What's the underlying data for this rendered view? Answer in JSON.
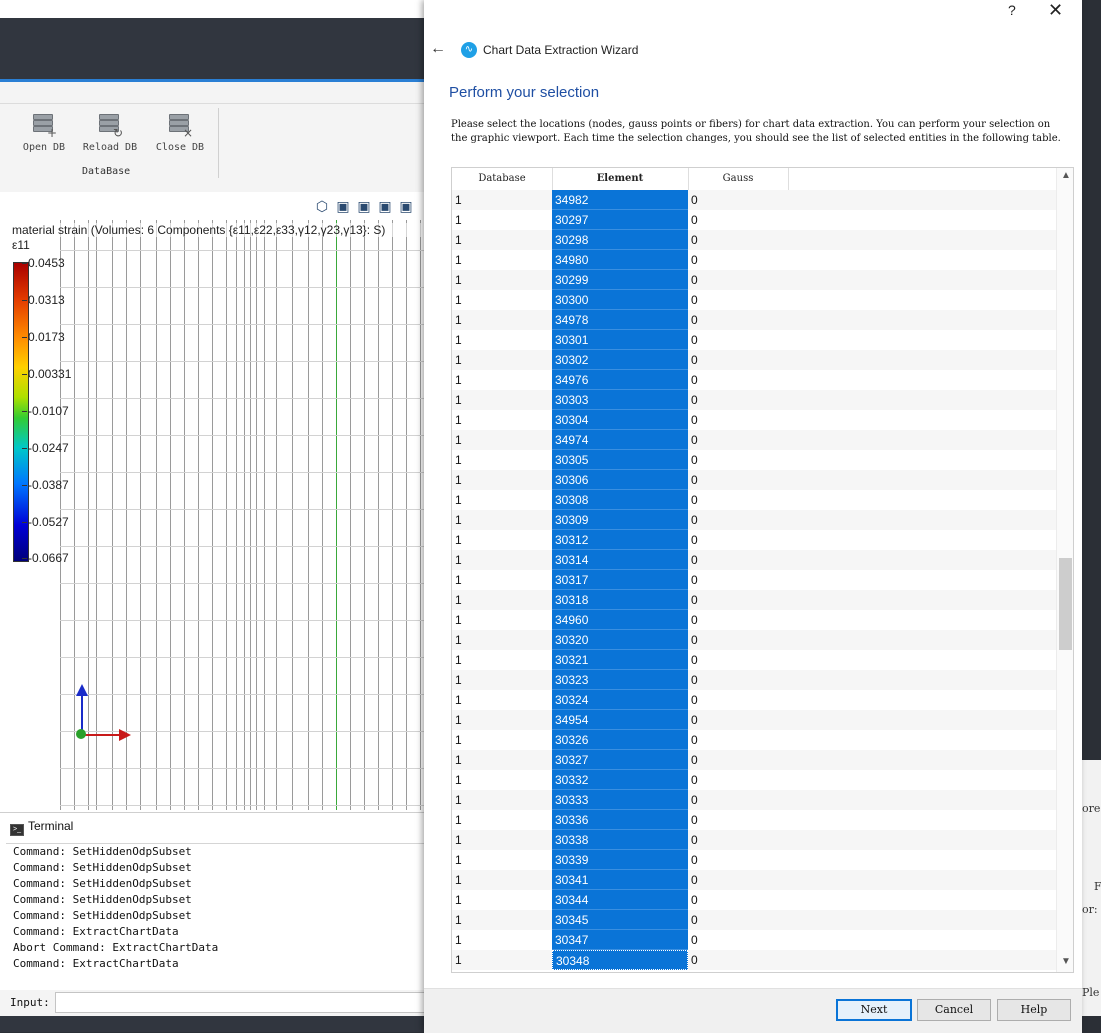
{
  "ribbon": {
    "buttons": [
      {
        "label": "Open DB",
        "badge": "+"
      },
      {
        "label": "Reload DB",
        "badge": "↻"
      },
      {
        "label": "Close DB",
        "badge": "×"
      }
    ],
    "group_label": "DataBase"
  },
  "viewport": {
    "legend_title": "material strain (Volumes: 6 Components {ε11,ε22,ε33,γ12,γ23,γ13}: S)",
    "legend_component": "ε11",
    "ticks": [
      "0.0453",
      "0.0313",
      "0.0173",
      "0.00331",
      "-0.0107",
      "-0.0247",
      "-0.0387",
      "-0.0527",
      "-0.0667"
    ]
  },
  "terminal": {
    "title": "Terminal",
    "lines": [
      "Command: SetHiddenOdpSubset",
      "Command: SetHiddenOdpSubset",
      "Command: SetHiddenOdpSubset",
      "Command: SetHiddenOdpSubset",
      "Command: SetHiddenOdpSubset",
      "Command: ExtractChartData",
      "Abort Command: ExtractChartData",
      "Command: ExtractChartData"
    ],
    "input_label": "Input:"
  },
  "right_fragments": [
    "ore",
    "F",
    "or:",
    "Ple"
  ],
  "dialog": {
    "help": "?",
    "close": "✕",
    "back": "←",
    "title": "Chart Data Extraction Wizard",
    "heading": "Perform your selection",
    "description": "Please select the locations (nodes, gauss points or fibers) for chart data extraction. You can perform your selection on the graphic viewport. Each time the selection changes, you should see the list of selected entities in the following table.",
    "columns": [
      "Database",
      "Element",
      "Gauss"
    ],
    "rows": [
      [
        "1",
        "34982",
        "0"
      ],
      [
        "1",
        "30297",
        "0"
      ],
      [
        "1",
        "30298",
        "0"
      ],
      [
        "1",
        "34980",
        "0"
      ],
      [
        "1",
        "30299",
        "0"
      ],
      [
        "1",
        "30300",
        "0"
      ],
      [
        "1",
        "34978",
        "0"
      ],
      [
        "1",
        "30301",
        "0"
      ],
      [
        "1",
        "30302",
        "0"
      ],
      [
        "1",
        "34976",
        "0"
      ],
      [
        "1",
        "30303",
        "0"
      ],
      [
        "1",
        "30304",
        "0"
      ],
      [
        "1",
        "34974",
        "0"
      ],
      [
        "1",
        "30305",
        "0"
      ],
      [
        "1",
        "30306",
        "0"
      ],
      [
        "1",
        "30308",
        "0"
      ],
      [
        "1",
        "30309",
        "0"
      ],
      [
        "1",
        "30312",
        "0"
      ],
      [
        "1",
        "30314",
        "0"
      ],
      [
        "1",
        "30317",
        "0"
      ],
      [
        "1",
        "30318",
        "0"
      ],
      [
        "1",
        "34960",
        "0"
      ],
      [
        "1",
        "30320",
        "0"
      ],
      [
        "1",
        "30321",
        "0"
      ],
      [
        "1",
        "30323",
        "0"
      ],
      [
        "1",
        "30324",
        "0"
      ],
      [
        "1",
        "34954",
        "0"
      ],
      [
        "1",
        "30326",
        "0"
      ],
      [
        "1",
        "30327",
        "0"
      ],
      [
        "1",
        "30332",
        "0"
      ],
      [
        "1",
        "30333",
        "0"
      ],
      [
        "1",
        "30336",
        "0"
      ],
      [
        "1",
        "30338",
        "0"
      ],
      [
        "1",
        "30339",
        "0"
      ],
      [
        "1",
        "30341",
        "0"
      ],
      [
        "1",
        "30344",
        "0"
      ],
      [
        "1",
        "30345",
        "0"
      ],
      [
        "1",
        "30347",
        "0"
      ],
      [
        "1",
        "30348",
        "0"
      ]
    ],
    "buttons": {
      "next": "Next",
      "cancel": "Cancel",
      "help": "Help"
    },
    "accent_color": "#0a74d7"
  }
}
